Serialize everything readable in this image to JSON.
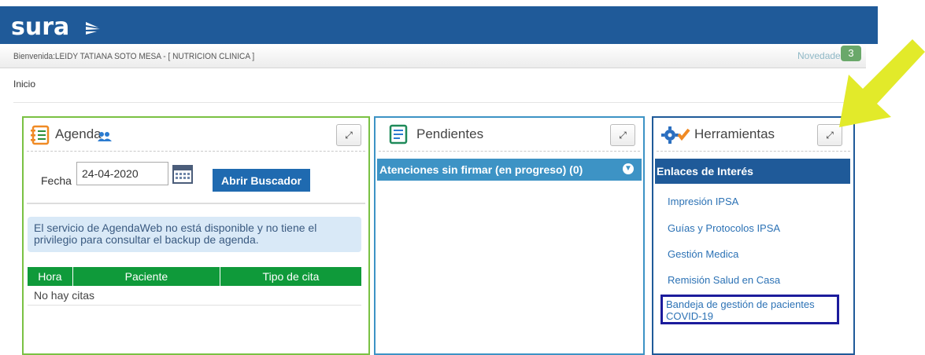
{
  "header": {
    "logo_text": "sura",
    "welcome": "Bienvenida:LEIDY TATIANA SOTO MESA - [ NUTRICION CLINICA ]",
    "novedades_label": "Novedades",
    "novedades_count": "3"
  },
  "breadcrumb": {
    "inicio": "Inicio"
  },
  "agenda": {
    "title": "Agenda",
    "fecha_label": "Fecha",
    "fecha_value": "24-04-2020",
    "abrir_buscador": "Abrir Buscador",
    "info_message": "El servicio de AgendaWeb no está disponible y no tiene el privilegio para consultar el backup de agenda.",
    "columns": [
      "Hora",
      "Paciente",
      "Tipo de cita"
    ],
    "empty_message": "No hay citas"
  },
  "pendientes": {
    "title": "Pendientes",
    "atenciones": "Atenciones sin firmar (en progreso) (0)"
  },
  "herramientas": {
    "title": "Herramientas",
    "enlaces_header": "Enlaces de Interés",
    "links": [
      "Impresión IPSA",
      "Guías y Protocolos IPSA",
      "Gestión Medica",
      "Remisión Salud en Casa",
      "Bandeja de gestión de pacientes COVID-19"
    ]
  },
  "colors": {
    "header_blue": "#1f5a99",
    "agenda_green": "#7ac143",
    "table_green": "#0f9a3a",
    "pendientes_blue": "#3d93c5",
    "annotation_arrow": "#e2ea2a"
  }
}
